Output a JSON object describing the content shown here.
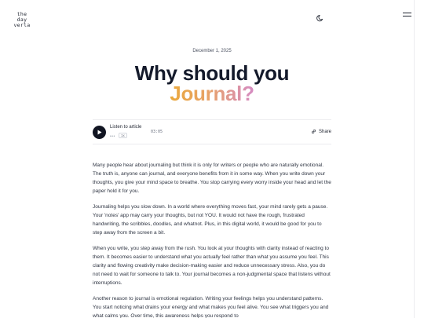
{
  "header": {
    "logo_lines": [
      "the",
      "day",
      "verla"
    ],
    "icons": {
      "theme": "moon-icon",
      "menu": "hamburger-menu-icon"
    }
  },
  "article": {
    "date": "December 1, 2025",
    "title_line1": "Why should you",
    "title_line2": "Journal?",
    "title_gradient": [
      "#eaa93c",
      "#e8a267",
      "#d58bc4"
    ],
    "player": {
      "listen_label": "Listen to article",
      "dots": "•••",
      "speed": "1x",
      "duration": "03:05",
      "share_label": "Share",
      "icons": {
        "play": "play-icon",
        "share": "link-icon"
      }
    },
    "paragraphs": [
      "Many people hear about journaling but think it is only for writers or people who are naturally emotional. The truth is, anyone can journal, and everyone benefits from it in some way. When you write down your thoughts, you give your mind space to breathe. You stop carrying every worry inside your head and let the paper hold it for you.",
      "Journaling helps you slow down. In a world where everything moves fast, your mind rarely gets a pause. Your 'notes' app may carry your thoughts, but not YOU. It would not have the rough, frustrated handwriting, the scribbles, doodles, and whatnot. Plus, in this digital world, it would be good for you to step away from the screen a bit.",
      "When you write, you step away from the rush. You look at your thoughts with clarity instead of reacting to them. It becomes easier to understand what you actually feel rather than what you assume you feel. This clarity and flowing creativity make decision-making easier and reduce unnecessary stress. Also, you do not need to wait for someone to talk to. Your journal becomes a non-judgmental space that listens without interruptions.",
      "Another reason to journal is emotional regulation. Writing your feelings helps you understand patterns. You start noticing what drains your energy and what makes you feel alive. You see what triggers you and what calms you. Over time, this awareness helps you respond to"
    ]
  },
  "colors": {
    "text": "#1f2430",
    "title": "#141a2b",
    "rule": "#ececef"
  }
}
